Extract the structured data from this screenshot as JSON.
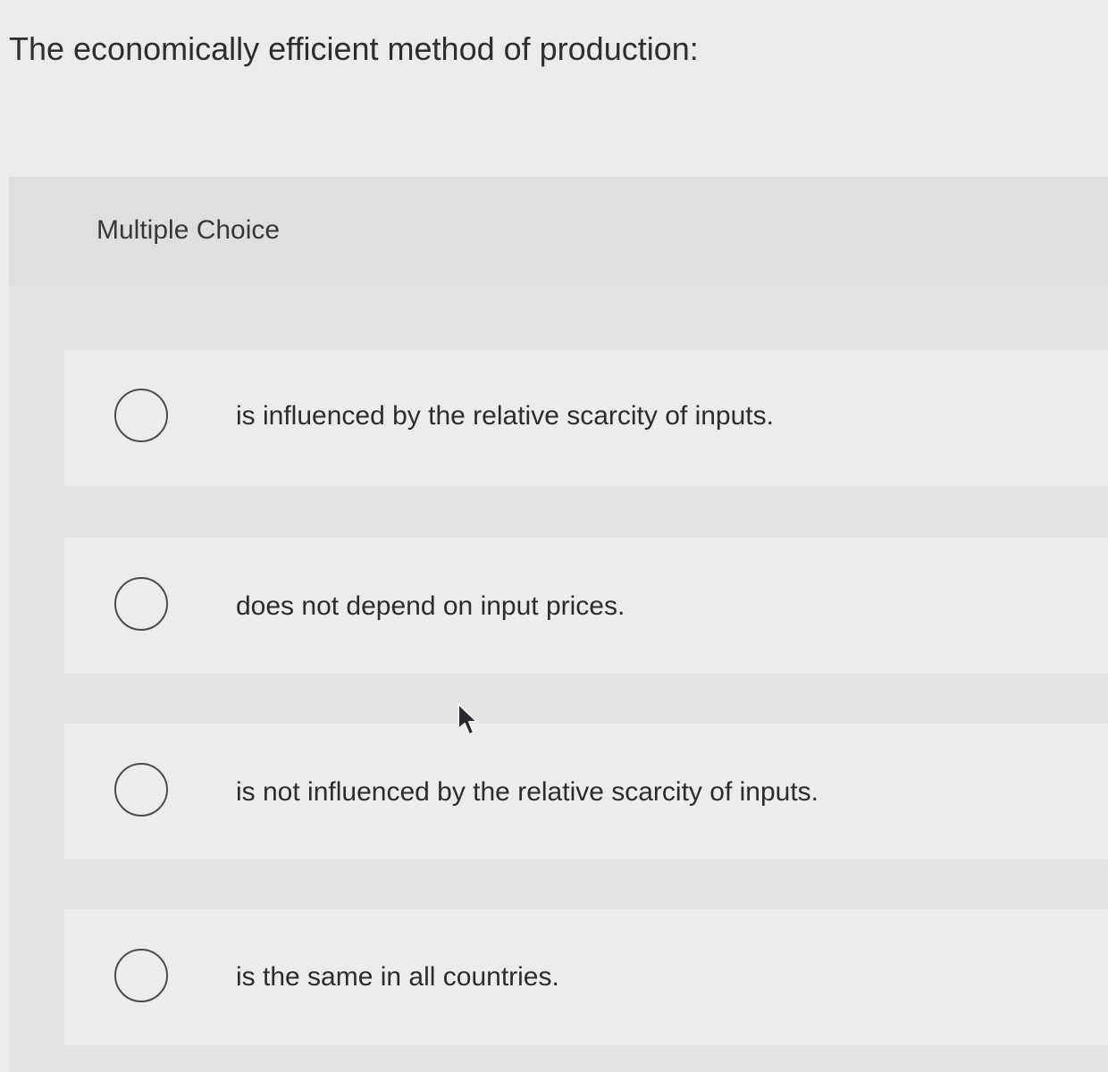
{
  "question": {
    "text": "The economically efficient method of production:"
  },
  "panel": {
    "type_label": "Multiple Choice"
  },
  "options": [
    {
      "text": "is influenced by the relative scarcity of inputs."
    },
    {
      "text": "does not depend on input prices."
    },
    {
      "text": "is not influenced by the relative scarcity of inputs."
    },
    {
      "text": "is the same in all countries."
    }
  ],
  "icons": {
    "radio": "radio-unselected-icon",
    "pointer": "mouse-pointer-icon"
  },
  "colors": {
    "page_background": "#ebebea",
    "panel_background": "#e4e4e3",
    "option_background": "#ececeb",
    "text": "#2b2b2d",
    "radio_border": "#4a4a52"
  }
}
